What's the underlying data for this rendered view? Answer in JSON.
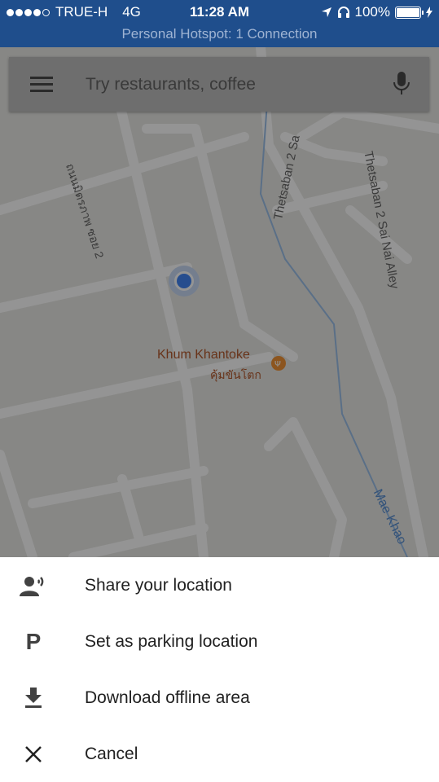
{
  "status_bar": {
    "carrier": "TRUE-H",
    "network": "4G",
    "time": "11:28 AM",
    "battery": "100%",
    "hotspot": "Personal Hotspot: 1 Connection"
  },
  "search": {
    "placeholder": "Try restaurants, coffee"
  },
  "map": {
    "place_name": "Khum Khantoke",
    "place_name_thai": "คุ้มขันโตก",
    "road_thai": "ถนนมิตรภาพ ซอย 2",
    "road_thetsaban": "Thetsaban 2 Sa",
    "road_sai_nai": "Thetsaban 2 Sai Nai Alley",
    "stream": "Mae Khao"
  },
  "sheet": {
    "items": [
      {
        "label": "Share your location",
        "icon": "share-location-icon"
      },
      {
        "label": "Set as parking location",
        "icon": "parking-icon"
      },
      {
        "label": "Download offline area",
        "icon": "download-icon"
      },
      {
        "label": "Cancel",
        "icon": "close-icon"
      }
    ]
  }
}
